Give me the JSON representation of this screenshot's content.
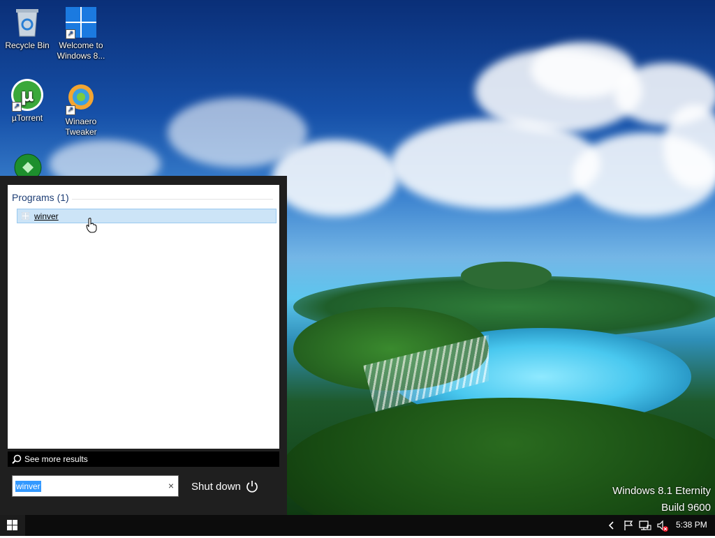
{
  "desktop": {
    "icons": [
      {
        "label": "Recycle Bin"
      },
      {
        "label": "Welcome to Windows 8..."
      },
      {
        "label": "µTorrent"
      },
      {
        "label": "Winaero Tweaker"
      }
    ],
    "watermark": {
      "line1": "Windows 8.1 Eternity",
      "line2": "Build 9600"
    }
  },
  "start_menu": {
    "section_header": "Programs (1)",
    "results": [
      {
        "label": "winver",
        "icon": "app-window-icon"
      }
    ],
    "see_more": "See more results",
    "search": {
      "value": "winver",
      "placeholder": ""
    },
    "shutdown_label": "Shut down"
  },
  "taskbar": {
    "clock": "5:38 PM",
    "tray_icons": [
      "chevron-left-icon",
      "flag-icon",
      "network-icon",
      "volume-muted-icon"
    ]
  }
}
